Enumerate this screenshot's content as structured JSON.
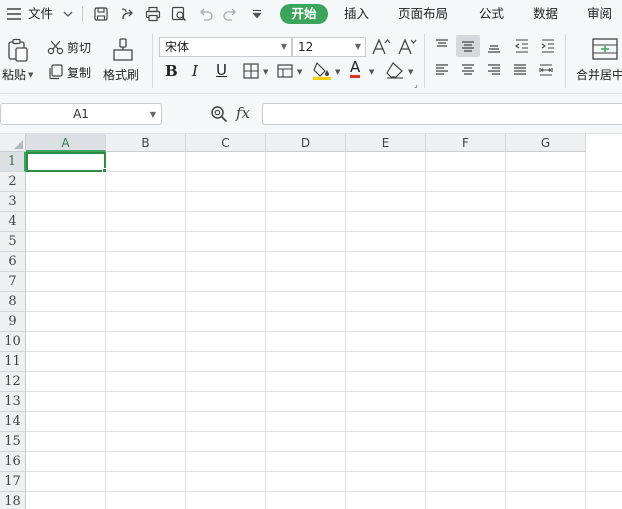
{
  "menu": {
    "file": "文件",
    "tabs": [
      {
        "label": "开始",
        "active": true
      },
      {
        "label": "插入"
      },
      {
        "label": "页面布局"
      },
      {
        "label": "公式"
      },
      {
        "label": "数据"
      },
      {
        "label": "审阅"
      }
    ],
    "accent_color": "#3ba55c"
  },
  "ribbon": {
    "clipboard": {
      "paste": "粘贴",
      "cut": "剪切",
      "copy": "复制",
      "format_painter": "格式刷"
    },
    "font": {
      "name": "宋体",
      "size": "12",
      "bold": "B",
      "italic": "I",
      "underline": "U",
      "font_color_letter": "A"
    },
    "merge": "合并居中"
  },
  "formula_bar": {
    "cell_ref": "A1",
    "fx": "fx",
    "content": ""
  },
  "sheet": {
    "columns": [
      "A",
      "B",
      "C",
      "D",
      "E",
      "F",
      "G"
    ],
    "rows": [
      "1",
      "2",
      "3",
      "4",
      "5",
      "6",
      "7",
      "8",
      "9",
      "10",
      "11",
      "12",
      "13",
      "14",
      "15",
      "16",
      "17",
      "18"
    ],
    "selected_cell": "A1",
    "selection_color": "#2e8b46"
  }
}
